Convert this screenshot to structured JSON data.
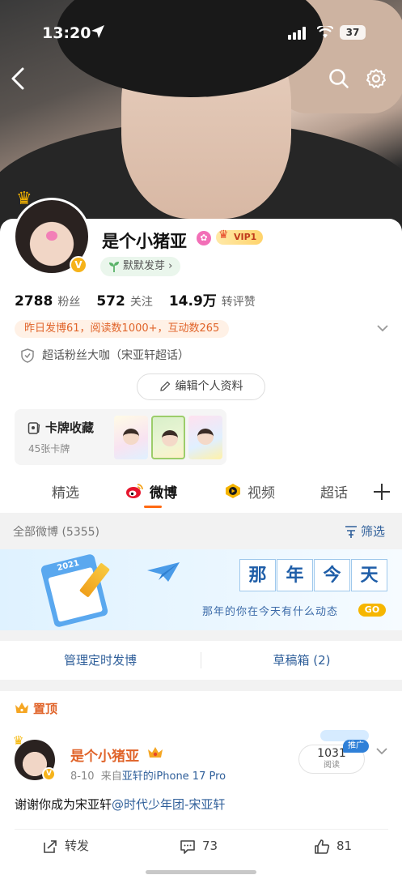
{
  "status_bar": {
    "time": "13:20",
    "battery": "37"
  },
  "profile": {
    "name": "是个小猪亚",
    "vip_label": "VIP1",
    "tag": "默默发芽",
    "tag_arrow": "›",
    "stats": [
      {
        "value": "2788",
        "label": "粉丝"
      },
      {
        "value": "572",
        "label": "关注"
      },
      {
        "value": "14.9万",
        "label": "转评赞"
      }
    ],
    "activity": "昨日发博61，阅读数1000+，互动数265",
    "super_topic": "超话粉丝大咖（宋亚轩超话）",
    "edit_button": "编辑个人资料",
    "card_collection": {
      "title": "卡牌收藏",
      "count": "45张卡牌"
    }
  },
  "tabs": [
    {
      "label": "精选",
      "active": false
    },
    {
      "label": "微博",
      "active": true
    },
    {
      "label": "视频",
      "active": false
    },
    {
      "label": "超话",
      "active": false
    }
  ],
  "feed": {
    "all_posts": "全部微博 (5355)",
    "filter": "筛选"
  },
  "banner": {
    "chars": [
      "那",
      "年",
      "今",
      "天"
    ],
    "subtitle": "那年的你在今天有什么动态",
    "go": "GO",
    "calendar_year": "2021"
  },
  "manage": {
    "scheduled": "管理定时发博",
    "drafts": "草稿箱 (2)"
  },
  "post": {
    "pinned": "置顶",
    "author": "是个小猪亚",
    "date": "8-10",
    "source_prefix": "来自",
    "source": "亚轩的iPhone 17 Pro",
    "reads": "1031",
    "reads_label": "阅读",
    "promo": "推广",
    "text": "谢谢你成为宋亚轩",
    "mention": "@时代少年团-宋亚轩",
    "actions": {
      "repost": "转发",
      "comments": "73",
      "likes": "81"
    }
  },
  "colors": {
    "accent": "#ff6a13",
    "link": "#2f5f9a",
    "orange_text": "#e0642a"
  }
}
